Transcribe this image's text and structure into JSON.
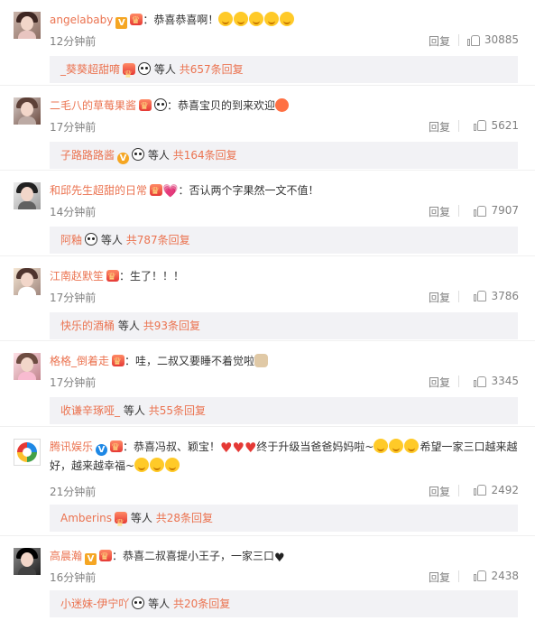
{
  "comments": [
    {
      "username": "angelababy",
      "content": "：恭喜恭喜啊！",
      "time": "12分钟前",
      "reply": "回复",
      "likes": "30885",
      "sub": {
        "name": "_葵葵超甜唷",
        "text": "等人",
        "count": "共657条回复"
      }
    },
    {
      "username": "二毛八的草莓果酱",
      "content": "：恭喜宝贝的到来欢迎",
      "time": "17分钟前",
      "reply": "回复",
      "likes": "5621",
      "sub": {
        "name": "子路路路酱",
        "text": "等人",
        "count": "共164条回复"
      }
    },
    {
      "username": "和邱先生超甜的日常",
      "content": "：否认两个字果然一文不值！",
      "time": "14分钟前",
      "reply": "回复",
      "likes": "7907",
      "sub": {
        "name": "阿釉",
        "text": "等人",
        "count": "共787条回复"
      }
    },
    {
      "username": "江南赵默笙",
      "content": "：生了！！！",
      "time": "17分钟前",
      "reply": "回复",
      "likes": "3786",
      "sub": {
        "name": "快乐的酒桶",
        "text": "等人",
        "count": "共93条回复"
      }
    },
    {
      "username": "格格_倒着走",
      "content": "：哇，二叔又要睡不着觉啦",
      "time": "17分钟前",
      "reply": "回复",
      "likes": "3345",
      "sub": {
        "name": "收谦辛琢哑_",
        "text": "等人",
        "count": "共55条回复"
      }
    },
    {
      "username": "腾讯娱乐",
      "content_a": "：恭喜冯叔、颖宝！",
      "content_b": "终于升级当爸爸妈妈啦~",
      "content_c": "希望一家三口越来越好，越来越幸福~",
      "time": "21分钟前",
      "reply": "回复",
      "likes": "2492",
      "sub": {
        "name": "Amberins",
        "text": "等人",
        "count": "共28条回复"
      }
    },
    {
      "username": "高晨瀚",
      "content": "：恭喜二叔喜提小王子，一家三口",
      "time": "16分钟前",
      "reply": "回复",
      "likes": "2438",
      "sub": {
        "name": "小迷妹-伊宁吖",
        "text": "等人",
        "count": "共20条回复"
      }
    }
  ],
  "colors": {
    "link": "#eb7350",
    "meta": "#808080",
    "subbox_bg": "#f2f2f5"
  },
  "icons": [
    "like-icon",
    "vip-v-icon",
    "crown-badge-icon",
    "panda-emoji-icon",
    "laugh-emoji-icon",
    "heart-icon"
  ]
}
